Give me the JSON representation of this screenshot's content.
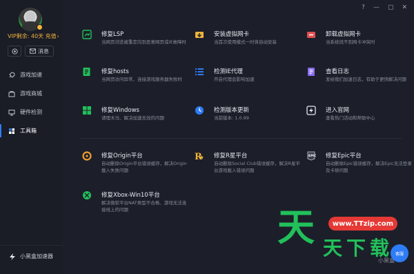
{
  "user": {
    "vip_text": "VIP剩余: 40天 充值",
    "vip_arrow": "›",
    "message_label": "消息"
  },
  "nav": [
    {
      "label": "游戏加速",
      "icon": "rocket-icon"
    },
    {
      "label": "游戏商城",
      "icon": "store-icon"
    },
    {
      "label": "硬件检测",
      "icon": "monitor-icon"
    },
    {
      "label": "工具箱",
      "icon": "toolbox-icon",
      "active": true
    }
  ],
  "footer": {
    "brand": "小黑盒加速器"
  },
  "window": {
    "help": "?",
    "min": "—",
    "max": "▢",
    "close": "✕"
  },
  "tools": [
    {
      "title": "修复LSP",
      "desc": "当网页浏览被重定向到恶意网页或IE故障时",
      "icon": "lsp-repair-icon",
      "color": "#22c05a"
    },
    {
      "title": "安装虚拟网卡",
      "desc": "当首次使用模式一时将自动安装",
      "icon": "install-nic-icon",
      "color": "#f0b43a"
    },
    {
      "title": "卸载虚拟网卡",
      "desc": "当系统找不到网卡冲突时",
      "icon": "uninstall-nic-icon",
      "color": "#e05050"
    },
    {
      "title": "修复hosts",
      "desc": "当网页访问异常、连接游戏服务器失败时",
      "icon": "hosts-repair-icon",
      "color": "#22c05a"
    },
    {
      "title": "检测IE代理",
      "desc": "开启代理会影响加速",
      "icon": "ie-proxy-icon",
      "color": "#2e7cf6"
    },
    {
      "title": "查看日志",
      "desc": "发给我们加速日志，有助于更快解决问题",
      "icon": "log-icon",
      "color": "#8a6cf0"
    },
    {
      "title": "修复Windows",
      "desc": "请理木马、解决加速无效的问题",
      "icon": "windows-repair-icon",
      "color": "#22c05a"
    },
    {
      "title": "检测版本更新",
      "desc": "当前版本: 1.0.99",
      "icon": "update-icon",
      "color": "#2e7cf6"
    },
    {
      "title": "进入官网",
      "desc": "查看热门活动和帮助中心",
      "icon": "website-icon",
      "color": "#e8eaf0"
    },
    {
      "title": "修复Origin平台",
      "desc": "自动删除Origin平台错误缓存，解决Origin載入失败问题",
      "icon": "origin-icon",
      "color": "#f0a030"
    },
    {
      "title": "修复R星平台",
      "desc": "自动删除Social Club错误缓存，解决R星平台游戏載入错误问题",
      "icon": "rockstar-icon",
      "color": "#f0b43a"
    },
    {
      "title": "修复Epic平台",
      "desc": "自动删除Epic错误缓存，解决Epic无法登录及卡顿问题",
      "icon": "epic-icon",
      "color": "#cfd2da"
    },
    {
      "title": "修复Xbox-Win10平台",
      "desc": "解决微软平台NAT类型不合格、游戏无法连接线上的问题",
      "icon": "xbox-icon",
      "color": "#22c05a"
    }
  ],
  "watermark": {
    "url": "www.TTzip.com",
    "big": "天",
    "small": "天下载",
    "logo": "小黑盒",
    "chat": "客服"
  }
}
